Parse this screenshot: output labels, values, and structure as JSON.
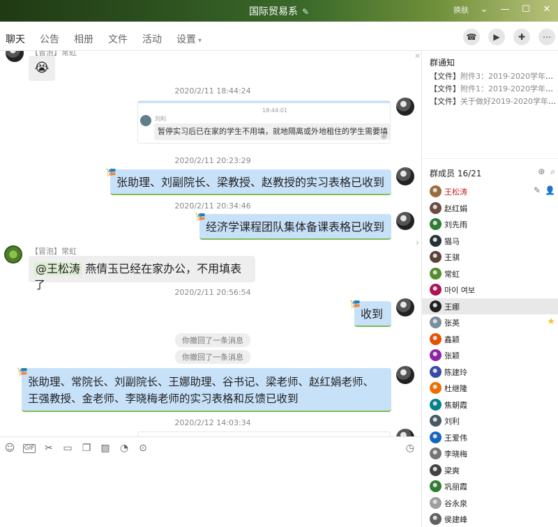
{
  "window": {
    "title": "国际贸易系",
    "skin_label": "换肤"
  },
  "tabs": [
    {
      "label": "聊天"
    },
    {
      "label": "公告"
    },
    {
      "label": "相册"
    },
    {
      "label": "文件"
    },
    {
      "label": "活动"
    },
    {
      "label": "设置"
    }
  ],
  "chat": {
    "top_sender": "【冒泡】常虹",
    "messages": {
      "ts1": "2020/2/11 18:44:24",
      "quote_time": "18:44:01",
      "quote_sender": "刘利",
      "quote_text": "暂停实习后已在家的学生不用填，就地隔离或外地租住的学生需要填",
      "ts2": "2020/2/11 20:23:29",
      "msg2": "张助理、刘副院长、梁教授、赵教授的实习表格已收到",
      "ts3": "2020/2/11 20:34:46",
      "msg3": "经济学课程团队集体备课表格已收到",
      "sender4": "【冒泡】常虹",
      "msg4_mention": "@王松涛",
      "msg4_text": " 燕倩玉已经在家办公，不用填表了",
      "ts5": "2020/2/11 20:56:54",
      "msg5": "收到",
      "recall1": "你撤回了一条消息",
      "recall2": "你撤回了一条消息",
      "msg6_line1": "张助理、常院长、刘副院长、王娜助理、谷书记、梁老师、赵红娟老师、",
      "msg6_line2": "王强教授、金老师、李晓梅老师的实习表格和反馈已收到",
      "ts7": "2020/2/12 14:03:34"
    }
  },
  "panel": {
    "notice_title": "群通知",
    "notices": [
      {
        "tag": "【文件】",
        "text": "附件3：2019-2020学年度第二..."
      },
      {
        "tag": "【文件】",
        "text": "附件1：2019-2020学年度第二..."
      },
      {
        "tag": "【文件】",
        "text": "关于做好2019-2020学年度第..."
      }
    ],
    "members_title": "群成员 16/21",
    "members": [
      {
        "name": "王松涛",
        "owner": true,
        "color": "#9c6b3a"
      },
      {
        "name": "赵红娟",
        "color": "#6d4c41"
      },
      {
        "name": "刘先雨",
        "color": "#2e7d32"
      },
      {
        "name": "猫马",
        "color": "#263238"
      },
      {
        "name": "王骐",
        "color": "#5d4037"
      },
      {
        "name": "常虹",
        "color": "#558b2f"
      },
      {
        "name": "마이 여보",
        "color": "#ad1457"
      },
      {
        "name": "王娜",
        "color": "#212121",
        "selected": true
      },
      {
        "name": "张英",
        "color": "#78909c",
        "star": true
      },
      {
        "name": "鑫颖",
        "color": "#e65100"
      },
      {
        "name": "张颖",
        "color": "#8e24aa"
      },
      {
        "name": "陈建玲",
        "color": "#3949ab"
      },
      {
        "name": "杜继隆",
        "color": "#ef6c00"
      },
      {
        "name": "焦朝霞",
        "color": "#00838f"
      },
      {
        "name": "刘利",
        "color": "#455a64"
      },
      {
        "name": "王爱伟",
        "color": "#1565c0"
      },
      {
        "name": "李晓梅",
        "color": "#757575"
      },
      {
        "name": "梁爽",
        "color": "#424242"
      },
      {
        "name": "巩丽霞",
        "color": "#2e7d32"
      },
      {
        "name": "谷永泉",
        "color": "#9e9e9e"
      },
      {
        "name": "侯建峰",
        "color": "#616161"
      }
    ]
  }
}
